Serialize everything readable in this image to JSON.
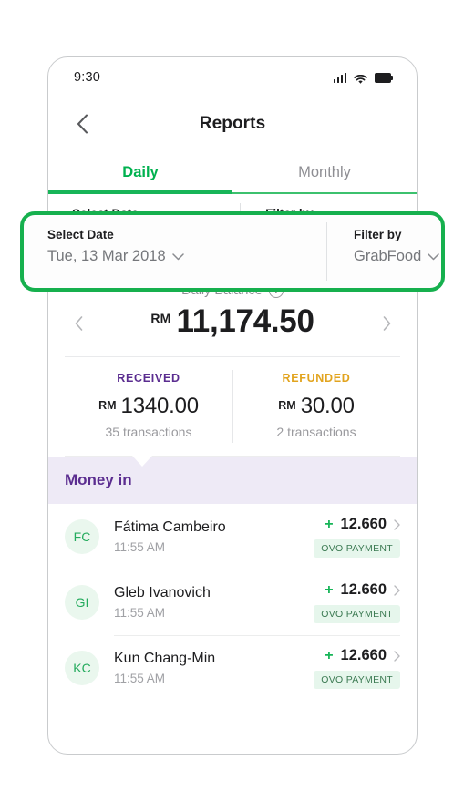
{
  "status_bar": {
    "time": "9:30",
    "icons": [
      "signal-icon",
      "wifi-icon",
      "battery-icon"
    ]
  },
  "nav": {
    "back_icon": "chevron-left-icon",
    "title": "Reports"
  },
  "tabs": [
    {
      "label": "Daily",
      "active": true
    },
    {
      "label": "Monthly",
      "active": false
    }
  ],
  "filters": {
    "date": {
      "label": "Select Date",
      "value": "Tue, 13 Mar 2018",
      "chevron": "chevron-down-icon"
    },
    "filter_by": {
      "label": "Filter by",
      "value": "GrabFood",
      "chevron": "chevron-down-icon"
    },
    "highlight_color": "#16b04e"
  },
  "balance": {
    "title": "Daily Balance",
    "info_icon": "info-icon",
    "prev_icon": "chevron-left-icon",
    "next_icon": "chevron-right-icon",
    "currency": "RM",
    "amount": "11,174.50"
  },
  "stats": [
    {
      "head": "RECEIVED",
      "currency": "RM",
      "amount": "1340.00",
      "sub": "35 transactions",
      "color": "#5b2d90"
    },
    {
      "head": "REFUNDED",
      "currency": "RM",
      "amount": "30.00",
      "sub": "2 transactions",
      "color": "#e2a41f"
    }
  ],
  "money_in": {
    "title": "Money in",
    "bg_color": "#eeeaf6",
    "text_color": "#5b2d90"
  },
  "transactions": [
    {
      "initials": "FC",
      "name": "Fátima Cambeiro",
      "time": "11:55 AM",
      "sign": "+",
      "amount": "12.660",
      "badge": "OVO PAYMENT",
      "chevron": "chevron-right-icon"
    },
    {
      "initials": "GI",
      "name": "Gleb Ivanovich",
      "time": "11:55 AM",
      "sign": "+",
      "amount": "12.660",
      "badge": "OVO PAYMENT",
      "chevron": "chevron-right-icon"
    },
    {
      "initials": "KC",
      "name": "Kun Chang-Min",
      "time": "11:55 AM",
      "sign": "+",
      "amount": "12.660",
      "badge": "OVO PAYMENT",
      "chevron": "chevron-right-icon"
    }
  ],
  "colors": {
    "brand_green": "#00b14f",
    "purple": "#5b2d90",
    "amber": "#e2a41f",
    "badge_bg": "#e6f6ec"
  }
}
